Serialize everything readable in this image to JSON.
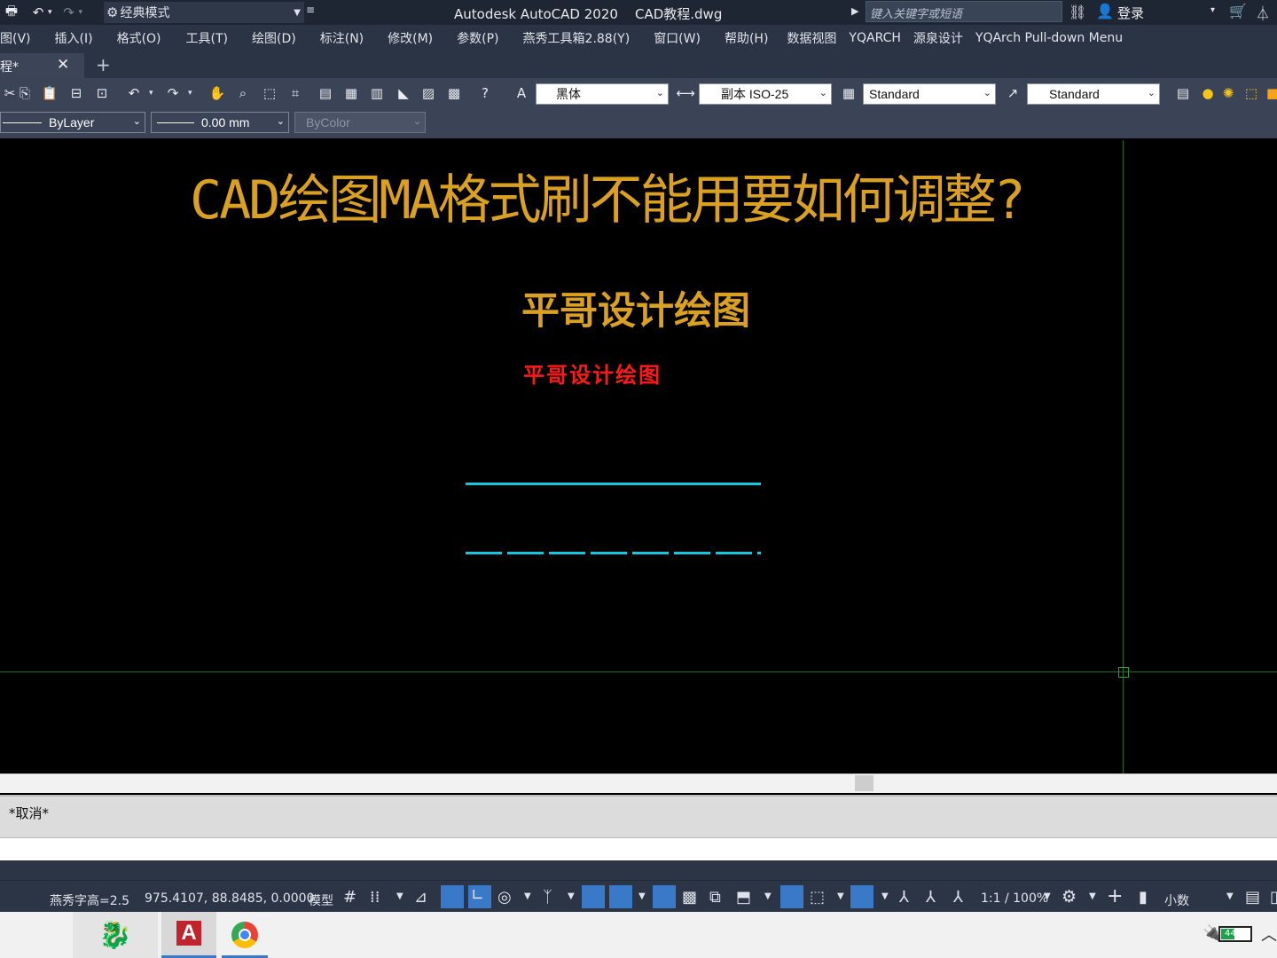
{
  "titlebar": {
    "workspace": "经典模式",
    "app_title": "Autodesk AutoCAD 2020    CAD教程.dwg",
    "search_placeholder": "键入关键字或短语",
    "login": "登录"
  },
  "menu": [
    "图(V)",
    "插入(I)",
    "格式(O)",
    "工具(T)",
    "绘图(D)",
    "标注(N)",
    "修改(M)",
    "参数(P)",
    "燕秀工具箱2.88(Y)",
    "窗口(W)",
    "帮助(H)",
    "数据视图",
    "YQARCH",
    "源泉设计",
    "YQArch Pull-down Menu"
  ],
  "tabs": {
    "active": "程*",
    "close": "✕",
    "add": "+"
  },
  "toolbar": {
    "text_style": "黑体",
    "dim_style": "副本 ISO-25",
    "table_style": "Standard",
    "multileader_style": "Standard",
    "linetype": "ByLayer",
    "lineweight": "0.00 mm",
    "plot_style": "ByColor"
  },
  "drawing": {
    "title": "CAD绘图MA格式刷不能用要如何调整?",
    "subtitle": "平哥设计绘图",
    "small_text": "平哥设计绘图",
    "colors": {
      "title": "#d9a021",
      "small": "#ff1a1a",
      "lines": "#19c6e0",
      "crosshair": "#1f6e1f"
    }
  },
  "command": {
    "history": "*取消*"
  },
  "status": {
    "text_height": "燕秀字高=2.5",
    "coordinates": "975.4107, 88.8485, 0.0000",
    "model": "模型",
    "scale": "1:1 / 100%",
    "units": "小数"
  },
  "taskbar": {
    "battery": "44%"
  }
}
